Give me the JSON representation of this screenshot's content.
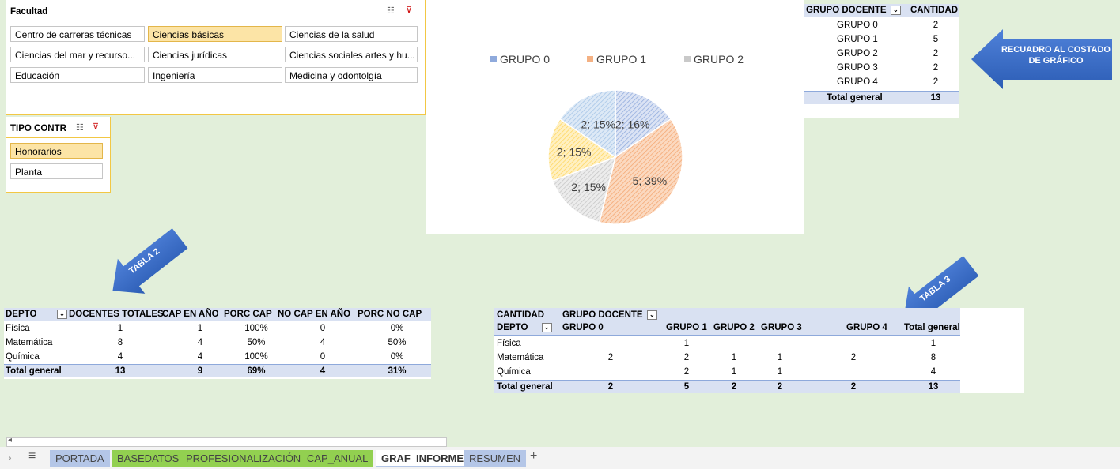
{
  "slicer_facultad": {
    "title": "Facultad",
    "items": [
      "Centro de carreras técnicas",
      "Ciencias básicas",
      "Ciencias de la salud",
      "Ciencias del mar y recurso...",
      "Ciencias jurídicas",
      "Ciencias sociales artes y hu...",
      "Educación",
      "Ingeniería",
      "Medicina y odontolgía"
    ],
    "selected_index": 1
  },
  "slicer_tipo": {
    "title": "TIPO CONTR",
    "items": [
      "Honorarios",
      "Planta"
    ],
    "selected_index": 0
  },
  "chart_data": {
    "type": "pie",
    "categories": [
      "GRUPO 0",
      "GRUPO 1",
      "GRUPO 2",
      "GRUPO 3",
      "GRUPO 4"
    ],
    "values": [
      2,
      5,
      2,
      2,
      2
    ],
    "data_labels": [
      "2; 16%",
      "5; 39%",
      "2; 15%",
      "2; 15%",
      "2; 15%"
    ],
    "legend": [
      "GRUPO 0",
      "GRUPO 1",
      "GRUPO 2"
    ],
    "legend_position": "top",
    "colors": [
      "#4472c4",
      "#ed7d31",
      "#a5a5a5",
      "#ffc000",
      "#5b9bd5"
    ]
  },
  "pivot1": {
    "col1": "GRUPO DOCENTE",
    "col2": "CANTIDAD",
    "rows": [
      [
        "GRUPO 0",
        "2"
      ],
      [
        "GRUPO 1",
        "5"
      ],
      [
        "GRUPO 2",
        "2"
      ],
      [
        "GRUPO 3",
        "2"
      ],
      [
        "GRUPO 4",
        "2"
      ]
    ],
    "total_label": "Total general",
    "total_value": "13"
  },
  "callout": {
    "text_line1": "RECUADRO AL COSTADO",
    "text_line2": "DE GRÁFICO"
  },
  "tabla2_arrow": "TABLA 2",
  "tabla3_arrow": "TABLA 3",
  "tabla2": {
    "headers": [
      "DEPTO",
      "DOCENTES TOTALES",
      "CAP EN AÑO",
      "PORC CAP",
      "NO CAP EN AÑO",
      "PORC NO CAP"
    ],
    "rows": [
      [
        "Física",
        "1",
        "1",
        "100%",
        "0",
        "0%"
      ],
      [
        "Matemática",
        "8",
        "4",
        "50%",
        "4",
        "50%"
      ],
      [
        "Química",
        "4",
        "4",
        "100%",
        "0",
        "0%"
      ]
    ],
    "total": [
      "Total general",
      "13",
      "9",
      "69%",
      "4",
      "31%"
    ]
  },
  "tabla3": {
    "label_cantidad": "CANTIDAD",
    "label_grupo": "GRUPO DOCENTE",
    "headers": [
      "DEPTO",
      "GRUPO 0",
      "GRUPO 1",
      "GRUPO 2",
      "GRUPO 3",
      "GRUPO 4",
      "Total general"
    ],
    "rows": [
      [
        "Física",
        "",
        "1",
        "",
        "",
        "",
        "1"
      ],
      [
        "Matemática",
        "2",
        "2",
        "1",
        "1",
        "2",
        "8"
      ],
      [
        "Química",
        "",
        "2",
        "1",
        "1",
        "",
        "4"
      ]
    ],
    "total": [
      "Total general",
      "2",
      "5",
      "2",
      "2",
      "2",
      "13"
    ]
  },
  "tabs": [
    "PORTADA",
    "BASEDATOS",
    "PROFESIONALIZACIÓN",
    "CAP_ANUAL",
    "GRAF_INFORME",
    "RESUMEN"
  ],
  "active_tab": "GRAF_INFORME"
}
